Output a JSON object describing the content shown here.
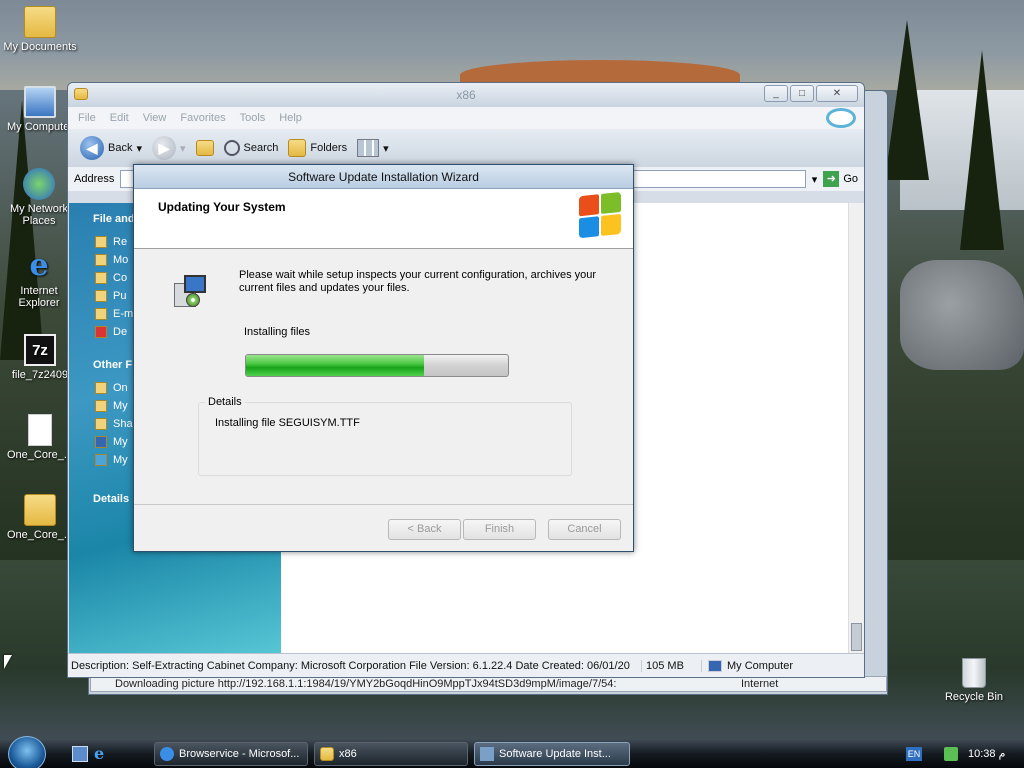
{
  "desktop": {
    "icons": [
      {
        "label": "My Documents",
        "icon": "folder-icon"
      },
      {
        "label": "My Computer",
        "icon": "computer-icon"
      },
      {
        "label": "My Network Places",
        "icon": "network-icon"
      },
      {
        "label": "Internet Explorer",
        "icon": "internet-explorer-icon"
      },
      {
        "label": "file_7z2409",
        "icon": "7zip-icon",
        "icon_text": "7z"
      },
      {
        "label": "One_Core_...",
        "icon": "document-icon"
      },
      {
        "label": "One_Core_...",
        "icon": "folder-icon"
      },
      {
        "label": "Recycle Bin",
        "icon": "recycle-bin-icon"
      }
    ]
  },
  "explorer": {
    "title": "x86",
    "menu": [
      "File",
      "Edit",
      "View",
      "Favorites",
      "Tools",
      "Help"
    ],
    "toolbar": {
      "back": "Back",
      "search": "Search",
      "folders": "Folders"
    },
    "address_label": "Address",
    "go_label": "Go",
    "task_pane": {
      "section1": "File and",
      "section1_items": [
        "Re",
        "Mo",
        "Co",
        "Pu",
        "E-m",
        "De"
      ],
      "section2": "Other F",
      "section2_items": [
        "On",
        "My",
        "Sha",
        "My",
        "My"
      ],
      "section3": "Details"
    },
    "status": {
      "description": "Description: Self-Extracting Cabinet Company: Microsoft Corporation File Version: 6.1.22.4 Date Created: 06/01/20",
      "size": "105 MB",
      "location": "My Computer"
    }
  },
  "ie_status": {
    "text": "Downloading picture http://192.168.1.1:1984/19/YMY2bGoqdHinO9MppTJx94tSD3d9mpM/image/7/54:",
    "zone": "Internet"
  },
  "wizard": {
    "title": "Software Update Installation Wizard",
    "heading": "Updating Your System",
    "description": "Please wait while setup inspects your current configuration, archives your current files and updates your files.",
    "status_label": "Installing files",
    "progress": 0.68,
    "details_legend": "Details",
    "details_text": "Installing file SEGUISYM.TTF",
    "buttons": {
      "back": "< Back",
      "finish": "Finish",
      "cancel": "Cancel"
    }
  },
  "taskbar": {
    "items": [
      {
        "label": "Browservice - Microsof...",
        "active": false
      },
      {
        "label": "x86",
        "active": false
      },
      {
        "label": "Software Update Inst...",
        "active": true
      }
    ],
    "language": "EN",
    "clock": "10:38 م"
  },
  "colors": {
    "progress_green": "#17a319",
    "task_pane_blue": "#2a7fb0",
    "taskbar_dark": "#141a20"
  }
}
